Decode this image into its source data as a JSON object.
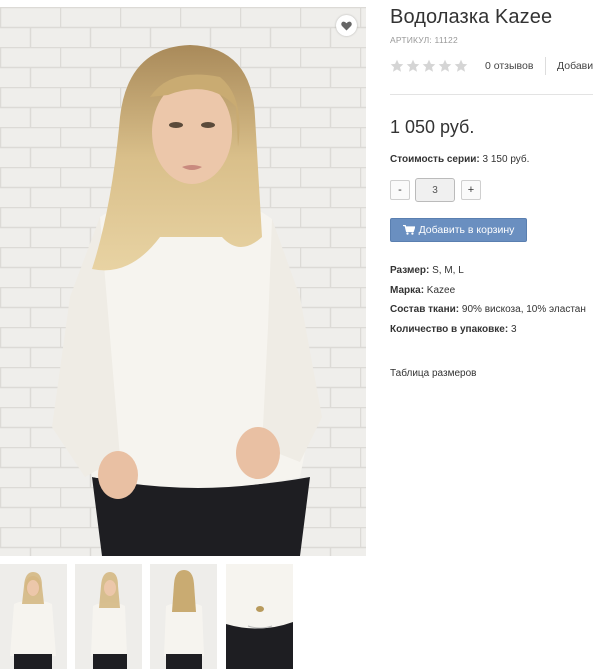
{
  "product": {
    "title": "Водолазка Kazee",
    "sku": "АРТИКУЛ: 11122",
    "rating_stars": 0,
    "rating_max": 5,
    "reviews_label": "0 отзывов",
    "add_review_label": "Добавить отзыв",
    "price": "1 050 руб.",
    "series_label": "Стоимость серии:",
    "series_value": " 3 150 руб.",
    "quantity": "3",
    "qty_minus": "-",
    "qty_plus": "+",
    "add_to_cart_label": "Добавить в корзину",
    "properties": [
      {
        "label": "Размер:",
        "value": " S, M, L"
      },
      {
        "label": "Марка:",
        "value": " Kazee"
      },
      {
        "label": "Состав ткани:",
        "value": " 90% вискоза, 10% эластан"
      },
      {
        "label": "Количество в упаковке:",
        "value": " 3"
      }
    ],
    "size_table_label": "Таблица размеров"
  },
  "gallery": {
    "thumbnail_count": 4
  },
  "colors": {
    "accent_button": "#6a8fc0",
    "star_empty": "#d5d5d5",
    "sweater": "#f6f4ef",
    "jeans": "#1e1e22",
    "brick": "#ecebe8"
  }
}
